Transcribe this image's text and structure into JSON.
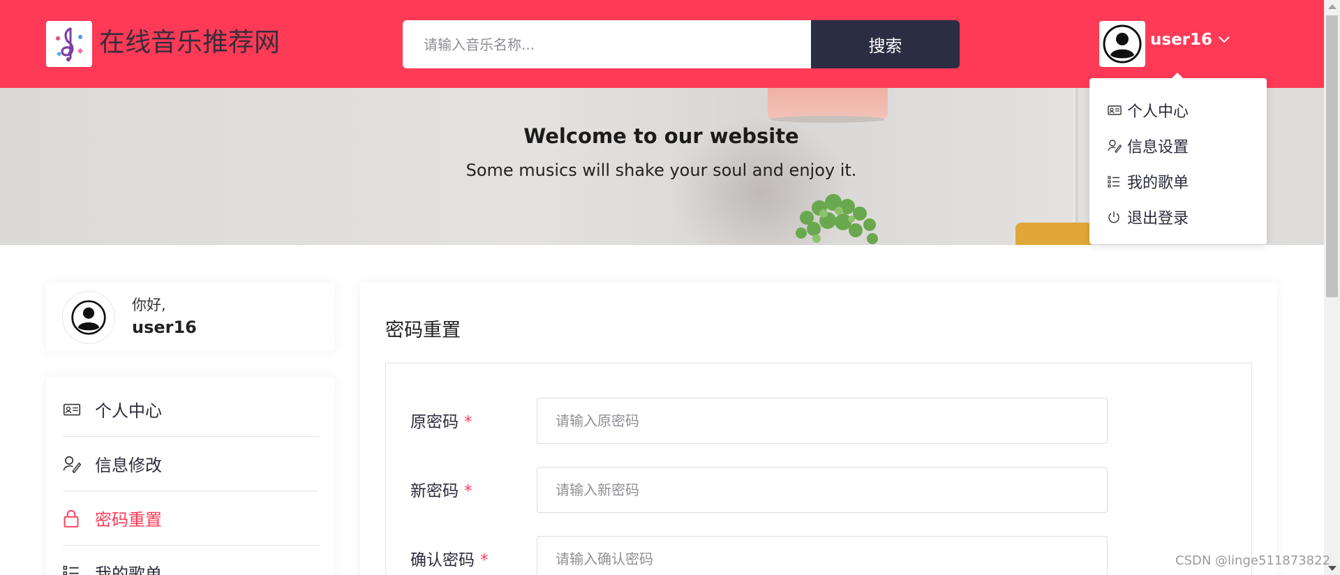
{
  "header": {
    "logo_icon": "music-note-icon",
    "site_title": "在线音乐推荐网",
    "search": {
      "placeholder": "请输入音乐名称...",
      "button_label": "搜索"
    },
    "user": {
      "avatar_icon": "user-avatar-icon",
      "name": "user16",
      "caret_icon": "chevron-down-icon"
    },
    "accent_color": "#fe3a57"
  },
  "hero": {
    "title": "Welcome to our website",
    "subtitle": "Some musics will shake your soul and enjoy it."
  },
  "user_dropdown": {
    "items": [
      {
        "label": "个人中心",
        "icon": "id-card-icon"
      },
      {
        "label": "信息设置",
        "icon": "user-edit-icon"
      },
      {
        "label": "我的歌单",
        "icon": "list-icon"
      },
      {
        "label": "退出登录",
        "icon": "power-icon"
      }
    ]
  },
  "user_card": {
    "greeting": "你好,",
    "username": "user16"
  },
  "side_menu": {
    "items": [
      {
        "label": "个人中心",
        "icon": "id-card-icon",
        "active": false
      },
      {
        "label": "信息修改",
        "icon": "user-edit-icon",
        "active": false
      },
      {
        "label": "密码重置",
        "icon": "lock-icon",
        "active": true
      },
      {
        "label": "我的歌单",
        "icon": "list-icon",
        "active": false
      }
    ]
  },
  "main": {
    "title": "密码重置",
    "form": {
      "fields": [
        {
          "label": "原密码",
          "required_mark": "*",
          "placeholder": "请输入原密码",
          "value": ""
        },
        {
          "label": "新密码",
          "required_mark": "*",
          "placeholder": "请输入新密码",
          "value": ""
        },
        {
          "label": "确认密码",
          "required_mark": "*",
          "placeholder": "请输入确认密码",
          "value": ""
        }
      ]
    }
  },
  "watermark": "CSDN @linge511873822"
}
